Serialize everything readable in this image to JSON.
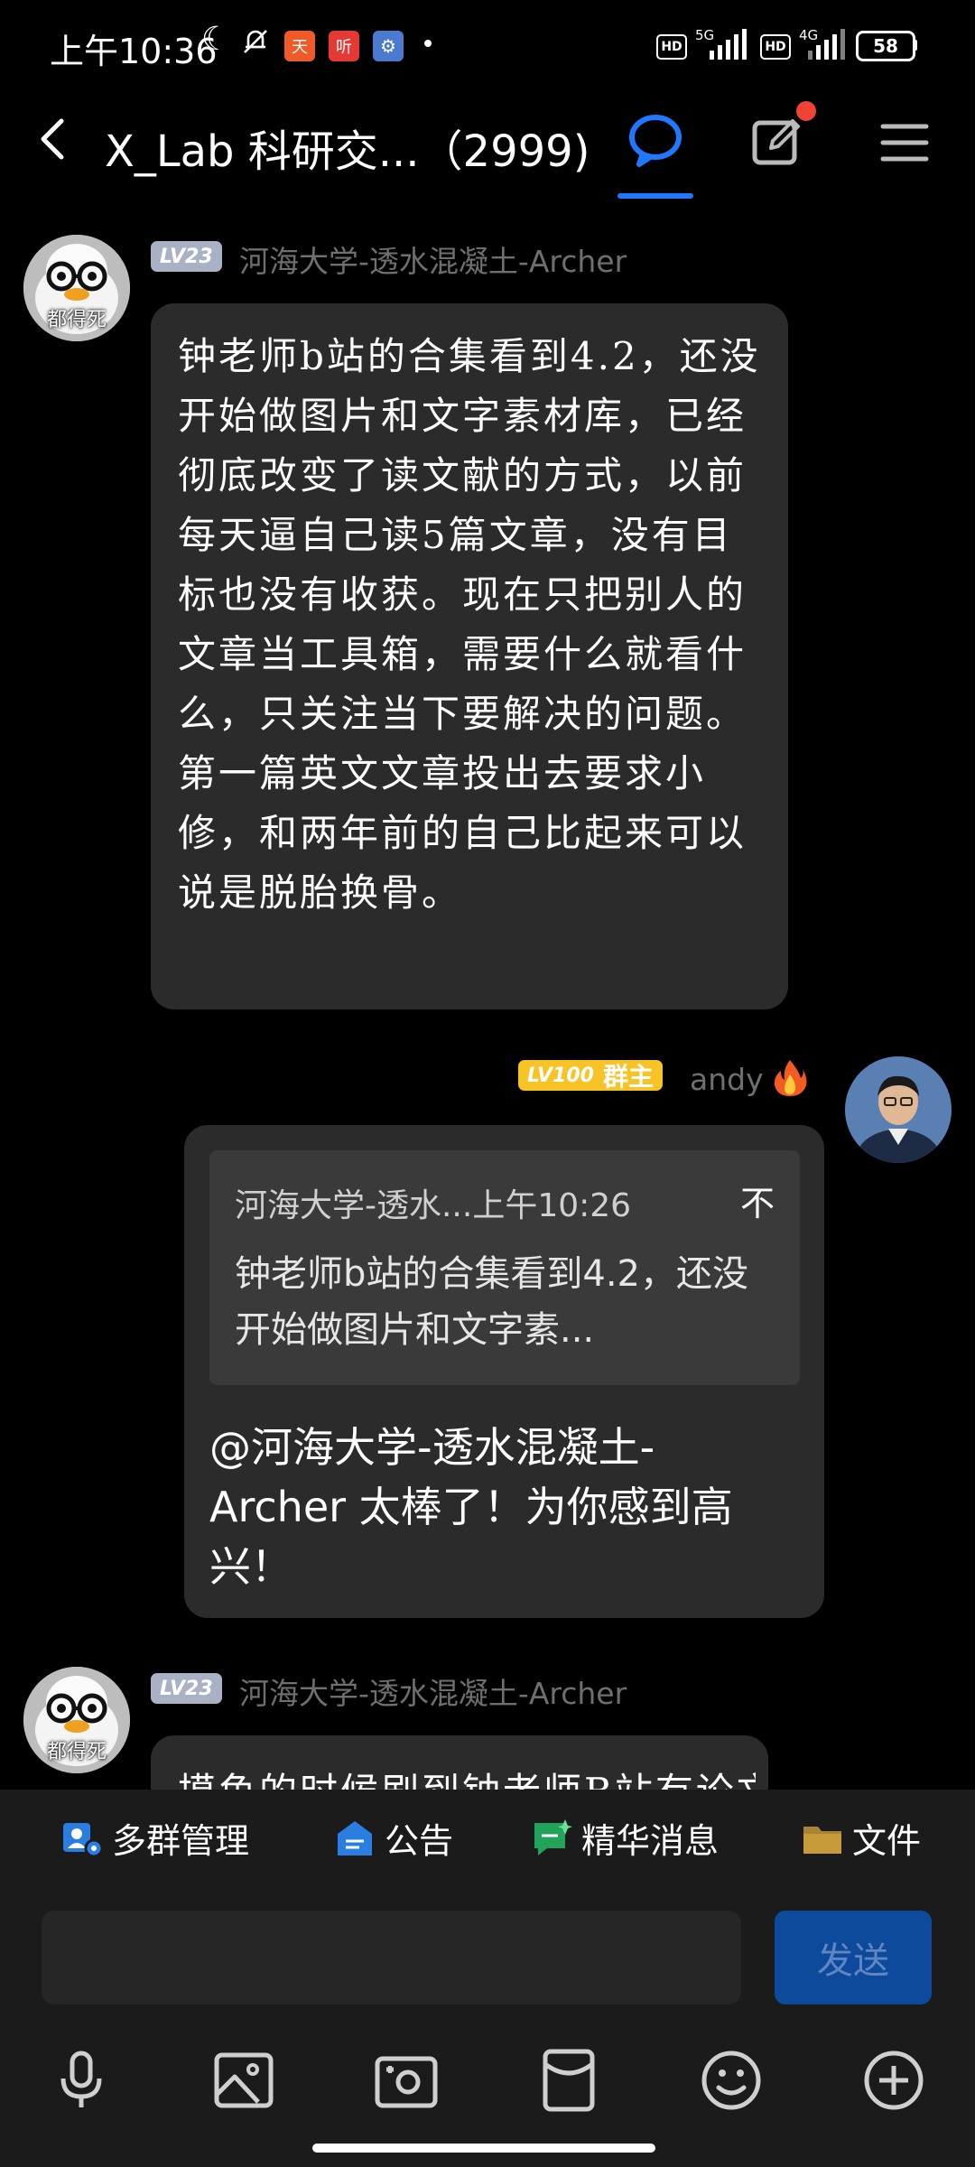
{
  "status_bar": {
    "time": "上午10:36",
    "app_icons": [
      "天",
      "听",
      "⚙"
    ],
    "sim1": {
      "hd": "HD",
      "network": "5G"
    },
    "sim2": {
      "hd": "HD",
      "network": "4G"
    },
    "battery": "58"
  },
  "header": {
    "title": "X_Lab 科研交...（2999)"
  },
  "messages": [
    {
      "level": "LV23",
      "sender": "河海大学-透水混凝土-Archer",
      "avatar_label": "都得死",
      "text": "钟老师b站的合集看到4.2，还没开始做图片和文字素材库，已经彻底改变了读文献的方式，以前每天逼自己读5篇文章，没有目标也没有收获。现在只把别人的文章当工具箱，需要什么就看什么，只关注当下要解决的问题。第一篇英文文章投出去要求小修，和两年前的自己比起来可以说是脱胎换骨。"
    },
    {
      "level": "LV100",
      "role": "群主",
      "sender": "andy",
      "quote_header": "河海大学-透水...上午10:26",
      "quote_text": "钟老师b站的合集看到4.2，还没开始做图片和文字素...",
      "quote_collapse": "不",
      "text": "@河海大学-透水混凝土-Archer 太棒了！为你感到高兴！"
    },
    {
      "level": "LV23",
      "sender": "河海大学-透水混凝土-Archer",
      "avatar_label": "都得死",
      "text": "摸鱼的时候刷到钟老师B站有论文"
    }
  ],
  "quick_bar": [
    {
      "label": "多群管理",
      "icon": "multi-group-icon",
      "color": "#2a7de1"
    },
    {
      "label": "公告",
      "icon": "announcement-icon",
      "color": "#2a7de1"
    },
    {
      "label": "精华消息",
      "icon": "highlight-message-icon",
      "color": "#21a35a"
    },
    {
      "label": "文件",
      "icon": "folder-icon",
      "color": "#c89a3a"
    }
  ],
  "input": {
    "placeholder": "",
    "send_label": "发送"
  },
  "colors": {
    "accent": "#1f78ff",
    "notification": "#f24236",
    "level_grey": "#a9b1c4",
    "level_gold": "#f7c325",
    "bubble": "#2b2b2b"
  }
}
